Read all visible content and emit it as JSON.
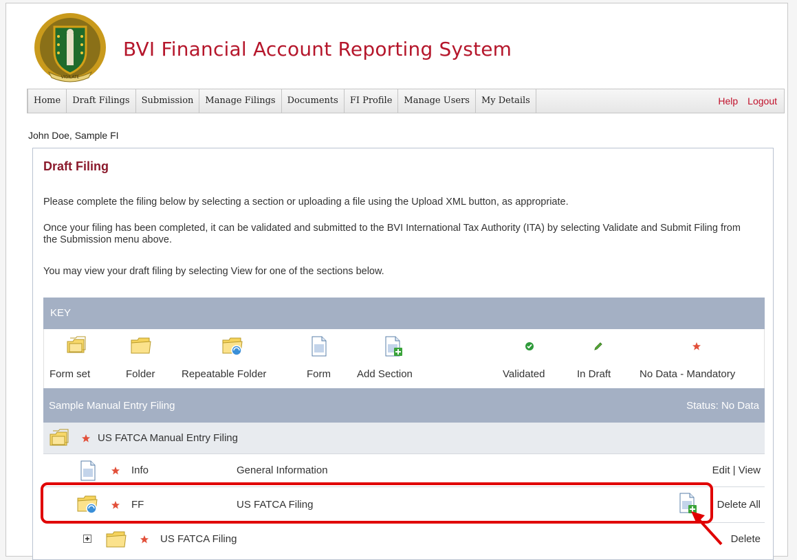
{
  "app": {
    "title": "BVI Financial Account Reporting System",
    "seal_text": "VIGILATE"
  },
  "nav": {
    "items": [
      "Home",
      "Draft Filings",
      "Submission",
      "Manage Filings",
      "Documents",
      "FI Profile",
      "Manage Users",
      "My Details"
    ],
    "help": "Help",
    "logout": "Logout"
  },
  "user": {
    "line": "John Doe, Sample FI"
  },
  "page": {
    "title": "Draft Filing",
    "para1": "Please complete the filing below by selecting a section or uploading a file using the Upload XML button, as appropriate.",
    "para2": "Once your filing has been completed, it can be validated and submitted to the BVI International Tax Authority (ITA) by selecting Validate and Submit Filing from the Submission menu above.",
    "para3": "You may view your draft filing by selecting View for one of the sections below."
  },
  "key": {
    "header": "KEY",
    "items": [
      {
        "label": "Form set",
        "icon": "form-set-icon"
      },
      {
        "label": "Folder",
        "icon": "folder-icon"
      },
      {
        "label": "Repeatable Folder",
        "icon": "repeatable-folder-icon"
      },
      {
        "label": "Form",
        "icon": "form-icon"
      },
      {
        "label": "Add Section",
        "icon": "add-section-icon"
      },
      {
        "label": "Validated",
        "icon": "validated-check-icon"
      },
      {
        "label": "In Draft",
        "icon": "in-draft-pencil-icon"
      },
      {
        "label": "No Data - Mandatory",
        "icon": "no-data-star-icon"
      }
    ]
  },
  "filing": {
    "name": "Sample Manual Entry Filing",
    "status": "Status: No Data",
    "group": {
      "label": "US FATCA Manual Entry Filing"
    },
    "rows": [
      {
        "code": "Info",
        "description": "General Information",
        "edit": "Edit",
        "sep": "|",
        "view": "View"
      },
      {
        "code": "FF",
        "description": "US FATCA Filing",
        "sep": "|",
        "delete_all": "Delete All"
      },
      {
        "label": "US FATCA Filing",
        "delete": "Delete"
      }
    ]
  },
  "colors": {
    "brand_red": "#b5162b",
    "title_maroon": "#8b1a2c",
    "bar_blue": "#a4b0c4",
    "highlight_red": "#e00000"
  }
}
